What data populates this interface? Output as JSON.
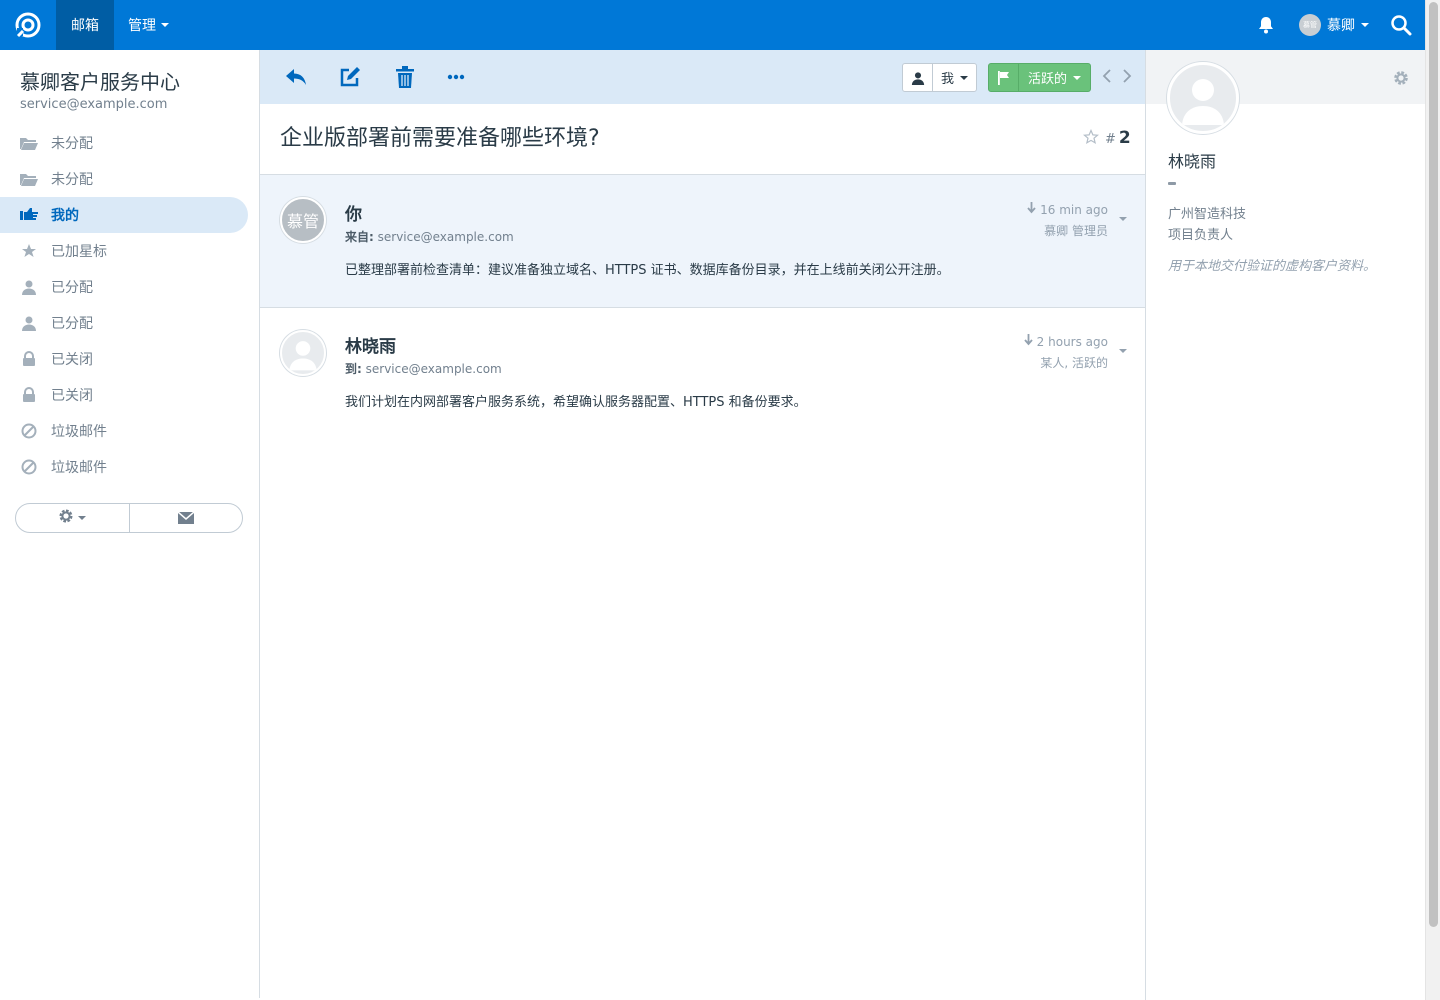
{
  "topbar": {
    "logo_icon": "helpdesk-logo-icon",
    "nav_mailbox": "邮箱",
    "nav_manage": "管理",
    "user_avatar_text": "慕管",
    "user_name": "慕卿",
    "bell_icon": "bell-icon",
    "search_icon": "search-icon",
    "brand_color": "#0078d7"
  },
  "sidebar": {
    "mailbox_name": "慕卿客户服务中心",
    "mailbox_email": "service@example.com",
    "folders": [
      {
        "label": "未分配",
        "icon": "folder-open-icon"
      },
      {
        "label": "未分配",
        "icon": "folder-open-icon"
      },
      {
        "label": "我的",
        "icon": "hand-pointing-icon",
        "active": true
      },
      {
        "label": "已加星标",
        "icon": "star-icon"
      },
      {
        "label": "已分配",
        "icon": "user-icon"
      },
      {
        "label": "已分配",
        "icon": "user-icon"
      },
      {
        "label": "已关闭",
        "icon": "lock-icon"
      },
      {
        "label": "已关闭",
        "icon": "lock-icon"
      },
      {
        "label": "垃圾邮件",
        "icon": "ban-icon"
      },
      {
        "label": "垃圾邮件",
        "icon": "ban-icon"
      }
    ],
    "actions": [
      "gear-icon",
      "envelope-icon"
    ]
  },
  "conversation": {
    "toolbar": {
      "assignee": "我",
      "status": "活跃的",
      "status_color": "#6ac27b"
    },
    "subject": "企业版部署前需要准备哪些环境?",
    "number_prefix": "#",
    "number": "2",
    "threads": [
      {
        "type": "note",
        "avatar_text": "慕管",
        "name": "你",
        "meta_label": "来自:",
        "meta_value": "service@example.com",
        "time": "16 min ago",
        "sub": "慕卿 管理员",
        "body": "已整理部署前检查清单：建议准备独立域名、HTTPS 证书、数据库备份目录，并在上线前关闭公开注册。"
      },
      {
        "type": "customer",
        "avatar_text": "",
        "name": "林晓雨",
        "meta_label": "到:",
        "meta_value": "service@example.com",
        "time": "2 hours ago",
        "sub": "某人, 活跃的",
        "body": "我们计划在内网部署客户服务系统，希望确认服务器配置、HTTPS 和备份要求。"
      }
    ]
  },
  "customer": {
    "name": "林晓雨",
    "company": "广州智造科技",
    "job_title": "项目负责人",
    "note": "用于本地交付验证的虚构客户资料。"
  }
}
